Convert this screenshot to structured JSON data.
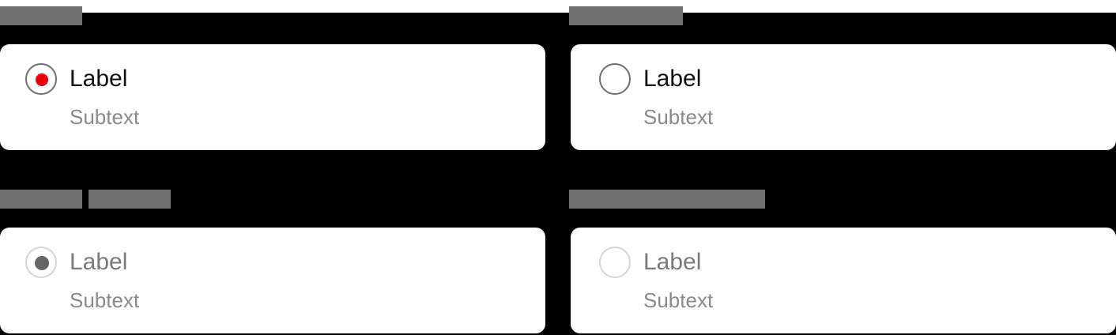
{
  "colors": {
    "accent": "#e8000b",
    "radio_border": "#6f6f6f",
    "disabled_border": "#d6d6d6",
    "disabled_dot": "#666666",
    "tag_fill": "#6f6f6f"
  },
  "options": [
    {
      "state": "selected",
      "label": "Label",
      "subtext": "Subtext"
    },
    {
      "state": "unselected",
      "label": "Label",
      "subtext": "Subtext"
    },
    {
      "state": "disabled-selected",
      "label": "Label",
      "subtext": "Subtext"
    },
    {
      "state": "disabled-unselected",
      "label": "Label",
      "subtext": "Subtext"
    }
  ]
}
